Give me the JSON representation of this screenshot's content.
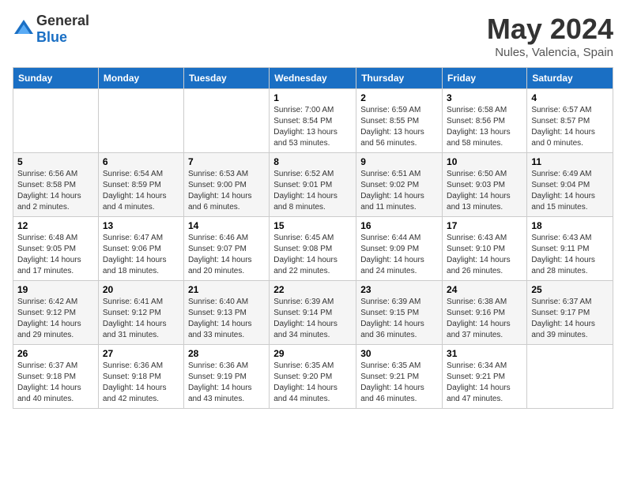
{
  "header": {
    "logo_general": "General",
    "logo_blue": "Blue",
    "month_title": "May 2024",
    "location": "Nules, Valencia, Spain"
  },
  "weekdays": [
    "Sunday",
    "Monday",
    "Tuesday",
    "Wednesday",
    "Thursday",
    "Friday",
    "Saturday"
  ],
  "weeks": [
    [
      {
        "day": "",
        "info": ""
      },
      {
        "day": "",
        "info": ""
      },
      {
        "day": "",
        "info": ""
      },
      {
        "day": "1",
        "info": "Sunrise: 7:00 AM\nSunset: 8:54 PM\nDaylight: 13 hours\nand 53 minutes."
      },
      {
        "day": "2",
        "info": "Sunrise: 6:59 AM\nSunset: 8:55 PM\nDaylight: 13 hours\nand 56 minutes."
      },
      {
        "day": "3",
        "info": "Sunrise: 6:58 AM\nSunset: 8:56 PM\nDaylight: 13 hours\nand 58 minutes."
      },
      {
        "day": "4",
        "info": "Sunrise: 6:57 AM\nSunset: 8:57 PM\nDaylight: 14 hours\nand 0 minutes."
      }
    ],
    [
      {
        "day": "5",
        "info": "Sunrise: 6:56 AM\nSunset: 8:58 PM\nDaylight: 14 hours\nand 2 minutes."
      },
      {
        "day": "6",
        "info": "Sunrise: 6:54 AM\nSunset: 8:59 PM\nDaylight: 14 hours\nand 4 minutes."
      },
      {
        "day": "7",
        "info": "Sunrise: 6:53 AM\nSunset: 9:00 PM\nDaylight: 14 hours\nand 6 minutes."
      },
      {
        "day": "8",
        "info": "Sunrise: 6:52 AM\nSunset: 9:01 PM\nDaylight: 14 hours\nand 8 minutes."
      },
      {
        "day": "9",
        "info": "Sunrise: 6:51 AM\nSunset: 9:02 PM\nDaylight: 14 hours\nand 11 minutes."
      },
      {
        "day": "10",
        "info": "Sunrise: 6:50 AM\nSunset: 9:03 PM\nDaylight: 14 hours\nand 13 minutes."
      },
      {
        "day": "11",
        "info": "Sunrise: 6:49 AM\nSunset: 9:04 PM\nDaylight: 14 hours\nand 15 minutes."
      }
    ],
    [
      {
        "day": "12",
        "info": "Sunrise: 6:48 AM\nSunset: 9:05 PM\nDaylight: 14 hours\nand 17 minutes."
      },
      {
        "day": "13",
        "info": "Sunrise: 6:47 AM\nSunset: 9:06 PM\nDaylight: 14 hours\nand 18 minutes."
      },
      {
        "day": "14",
        "info": "Sunrise: 6:46 AM\nSunset: 9:07 PM\nDaylight: 14 hours\nand 20 minutes."
      },
      {
        "day": "15",
        "info": "Sunrise: 6:45 AM\nSunset: 9:08 PM\nDaylight: 14 hours\nand 22 minutes."
      },
      {
        "day": "16",
        "info": "Sunrise: 6:44 AM\nSunset: 9:09 PM\nDaylight: 14 hours\nand 24 minutes."
      },
      {
        "day": "17",
        "info": "Sunrise: 6:43 AM\nSunset: 9:10 PM\nDaylight: 14 hours\nand 26 minutes."
      },
      {
        "day": "18",
        "info": "Sunrise: 6:43 AM\nSunset: 9:11 PM\nDaylight: 14 hours\nand 28 minutes."
      }
    ],
    [
      {
        "day": "19",
        "info": "Sunrise: 6:42 AM\nSunset: 9:12 PM\nDaylight: 14 hours\nand 29 minutes."
      },
      {
        "day": "20",
        "info": "Sunrise: 6:41 AM\nSunset: 9:12 PM\nDaylight: 14 hours\nand 31 minutes."
      },
      {
        "day": "21",
        "info": "Sunrise: 6:40 AM\nSunset: 9:13 PM\nDaylight: 14 hours\nand 33 minutes."
      },
      {
        "day": "22",
        "info": "Sunrise: 6:39 AM\nSunset: 9:14 PM\nDaylight: 14 hours\nand 34 minutes."
      },
      {
        "day": "23",
        "info": "Sunrise: 6:39 AM\nSunset: 9:15 PM\nDaylight: 14 hours\nand 36 minutes."
      },
      {
        "day": "24",
        "info": "Sunrise: 6:38 AM\nSunset: 9:16 PM\nDaylight: 14 hours\nand 37 minutes."
      },
      {
        "day": "25",
        "info": "Sunrise: 6:37 AM\nSunset: 9:17 PM\nDaylight: 14 hours\nand 39 minutes."
      }
    ],
    [
      {
        "day": "26",
        "info": "Sunrise: 6:37 AM\nSunset: 9:18 PM\nDaylight: 14 hours\nand 40 minutes."
      },
      {
        "day": "27",
        "info": "Sunrise: 6:36 AM\nSunset: 9:18 PM\nDaylight: 14 hours\nand 42 minutes."
      },
      {
        "day": "28",
        "info": "Sunrise: 6:36 AM\nSunset: 9:19 PM\nDaylight: 14 hours\nand 43 minutes."
      },
      {
        "day": "29",
        "info": "Sunrise: 6:35 AM\nSunset: 9:20 PM\nDaylight: 14 hours\nand 44 minutes."
      },
      {
        "day": "30",
        "info": "Sunrise: 6:35 AM\nSunset: 9:21 PM\nDaylight: 14 hours\nand 46 minutes."
      },
      {
        "day": "31",
        "info": "Sunrise: 6:34 AM\nSunset: 9:21 PM\nDaylight: 14 hours\nand 47 minutes."
      },
      {
        "day": "",
        "info": ""
      }
    ]
  ]
}
